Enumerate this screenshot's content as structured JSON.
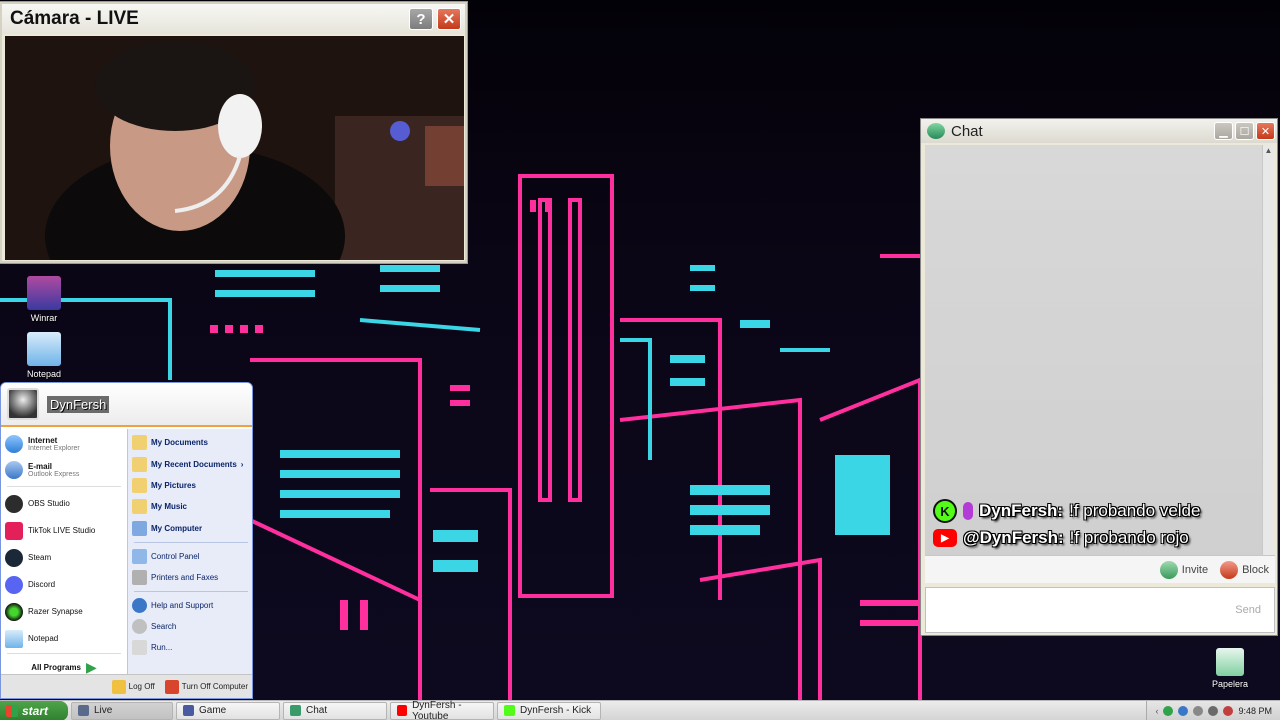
{
  "camera_window": {
    "title": "Cámara - LIVE",
    "help_label": "?",
    "close_label": "✕"
  },
  "desktop_icons": [
    {
      "label": "Winrar",
      "color": "#8b3a8f"
    },
    {
      "label": "Notepad",
      "color": "#6fb3e8"
    },
    {
      "label": "Papelera",
      "color": "#7fd0a0"
    }
  ],
  "chat_window": {
    "title": "Chat",
    "messages": [
      {
        "platform": "kick",
        "user": "DynFersh:",
        "text": "!f probando velde"
      },
      {
        "platform": "youtube",
        "user": "@DynFersh:",
        "text": "!f probando rojo"
      }
    ],
    "invite_label": "Invite",
    "block_label": "Block",
    "send_label": "Send",
    "input_value": ""
  },
  "start_menu": {
    "username": "DynFersh",
    "pinned": [
      {
        "title": "Internet",
        "subtitle": "Internet Explorer",
        "color": "#2f7fd6"
      },
      {
        "title": "E-mail",
        "subtitle": "Outlook Express",
        "color": "#3a78c7"
      }
    ],
    "programs": [
      {
        "label": "OBS Studio",
        "color": "#2c2c2c"
      },
      {
        "label": "TikTok LIVE Studio",
        "color": "#e4205a"
      },
      {
        "label": "Steam",
        "color": "#1b2838"
      },
      {
        "label": "Discord",
        "color": "#5865f2"
      },
      {
        "label": "Razer Synapse",
        "color": "#1a1a1a"
      },
      {
        "label": "Notepad",
        "color": "#6fb3e8"
      }
    ],
    "all_programs_label": "All Programs",
    "places": [
      {
        "label": "My Documents",
        "bold": true
      },
      {
        "label": "My Recent Documents",
        "bold": true,
        "arrow": "›"
      },
      {
        "label": "My Pictures",
        "bold": true
      },
      {
        "label": "My Music",
        "bold": true
      },
      {
        "label": "My Computer",
        "bold": true
      },
      {
        "label": "Control Panel",
        "bold": false
      },
      {
        "label": "Printers and Faxes",
        "bold": false
      },
      {
        "label": "Help and Support",
        "bold": false
      },
      {
        "label": "Search",
        "bold": false
      },
      {
        "label": "Run...",
        "bold": false
      }
    ],
    "log_off_label": "Log Off",
    "turn_off_label": "Turn Off Computer"
  },
  "taskbar": {
    "start_label": "start",
    "tasks": [
      {
        "label": "Live",
        "icon": "camera-icon",
        "active": true
      },
      {
        "label": "Game",
        "icon": "game-icon",
        "active": false
      },
      {
        "label": "Chat",
        "icon": "chat-icon",
        "active": false
      },
      {
        "label": "DynFersh - Youtube",
        "icon": "youtube-icon",
        "active": false
      },
      {
        "label": "DynFersh - Kick",
        "icon": "kick-icon",
        "active": false
      }
    ],
    "clock": "9:48 PM"
  }
}
